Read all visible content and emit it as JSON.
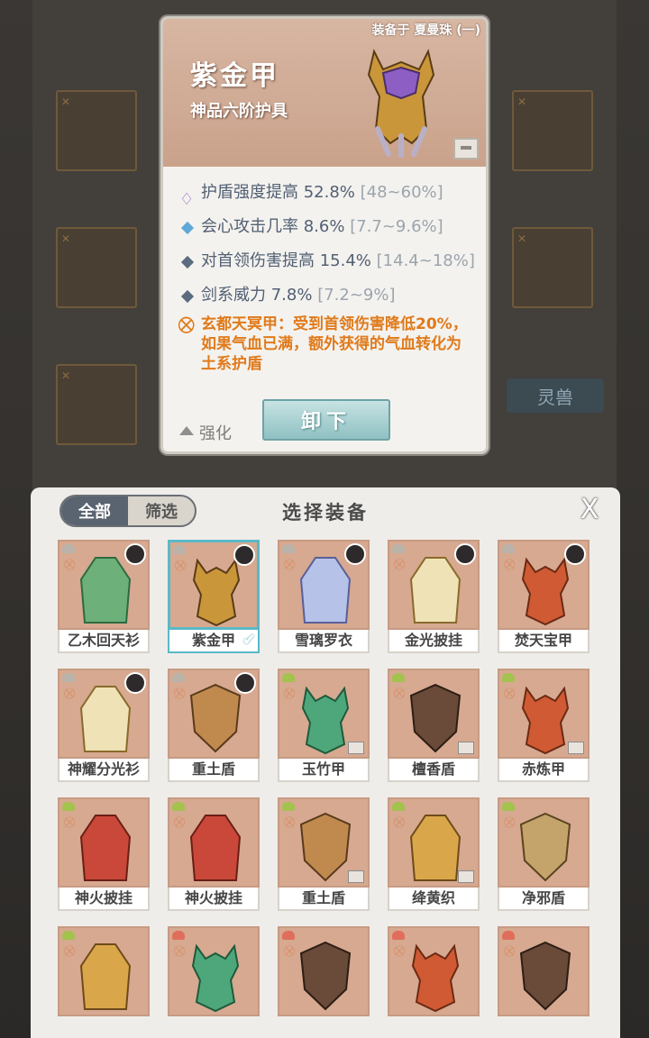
{
  "background": {
    "spirit_beast_label": "灵兽"
  },
  "tooltip": {
    "equipped_by": "装备于 夏曼珠 (一)",
    "name": "紫金甲",
    "rank": "神品六阶护具",
    "stats": [
      {
        "text": "护盾强度提高 52.8%",
        "range": "[48~60%]",
        "icon": "shield-icon"
      },
      {
        "text": "会心攻击几率 8.6%",
        "range": "[7.7~9.6%]",
        "icon": "diamond-icon"
      },
      {
        "text": "对首领伤害提高 15.4%",
        "range": "[14.4~18%]",
        "icon": "diamond-icon"
      },
      {
        "text": "剑系威力 7.8%",
        "range": "[7.2~9%]",
        "icon": "diamond-icon"
      }
    ],
    "special_text": "玄都天冥甲：受到首领伤害降低20%，如果气血已满，额外获得的气血转化为土系护盾",
    "enhance_label": "强化",
    "unequip_label": "卸下"
  },
  "panel": {
    "title": "选择装备",
    "tabs": [
      {
        "label": "全部",
        "active": true
      },
      {
        "label": "筛选",
        "active": false
      }
    ],
    "close_label": "X",
    "items": [
      {
        "name": "乙木回天衫",
        "art": "robe-green",
        "avatar": true
      },
      {
        "name": "紫金甲",
        "art": "armor-gold",
        "avatar": true,
        "selected": true
      },
      {
        "name": "雪璃罗衣",
        "art": "robe-blue",
        "avatar": true
      },
      {
        "name": "金光披挂",
        "art": "robe-cream",
        "avatar": true
      },
      {
        "name": "焚天宝甲",
        "art": "armor-red",
        "avatar": true
      },
      {
        "name": "神耀分光衫",
        "art": "robe-cream",
        "avatar": true
      },
      {
        "name": "重土盾",
        "art": "shield-bronze",
        "avatar": true
      },
      {
        "name": "玉竹甲",
        "art": "armor-green",
        "box": true
      },
      {
        "name": "檀香盾",
        "art": "shield-dark",
        "box": true
      },
      {
        "name": "赤炼甲",
        "art": "armor-red",
        "box": true
      },
      {
        "name": "神火披挂",
        "art": "cape-red"
      },
      {
        "name": "神火披挂",
        "art": "cape-red"
      },
      {
        "name": "重土盾",
        "art": "shield-bronze",
        "box": true
      },
      {
        "name": "绛黄织",
        "art": "robe-gold",
        "box": true
      },
      {
        "name": "净邪盾",
        "art": "shield-gold"
      },
      {
        "name": "",
        "art": "robe-gold"
      },
      {
        "name": "",
        "art": "armor-green"
      },
      {
        "name": "",
        "art": "shield-dark"
      },
      {
        "name": "",
        "art": "armor-red"
      },
      {
        "name": "",
        "art": "shield-dark"
      }
    ]
  },
  "colors": {
    "special": "#e07a1b",
    "selected_border": "#5ab9c7",
    "tile_bg": "#d6a990"
  }
}
